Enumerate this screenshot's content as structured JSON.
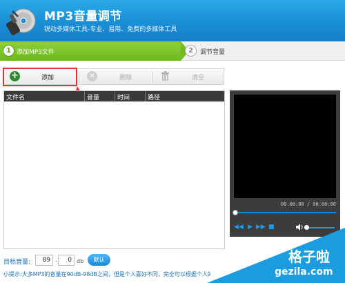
{
  "header": {
    "title": "MP3音量调节",
    "subtitle": "锐动多媒体工具-专业、易用、免费的多媒体工具"
  },
  "steps": [
    {
      "num": "1",
      "label": "添加MP3文件",
      "active": true
    },
    {
      "num": "2",
      "label": "调节音量",
      "active": false
    }
  ],
  "toolbar": {
    "add_label": "添加",
    "delete_label": "删除",
    "clear_label": "清空"
  },
  "filelist": {
    "columns": [
      "文件名",
      "音量",
      "时间",
      "路径"
    ],
    "rows": []
  },
  "player": {
    "time": "00:00:00 / 00:00:00"
  },
  "volume": {
    "label": "目标音量:",
    "integer": "89",
    "dot": ".",
    "decimal": "0",
    "unit": "db",
    "default_label": "默认"
  },
  "tip": "小提示:大多MP3的音量在90dB-98dB之间，但是个人喜好不同，完全可以根据个人的爱好再",
  "watermark": {
    "line1": "格子啦",
    "line2": "gezila.com"
  },
  "colors": {
    "header": "#1a8fd6",
    "step_active": "#74bc22",
    "highlight": "#e5302d",
    "accent": "#1e9be8"
  }
}
